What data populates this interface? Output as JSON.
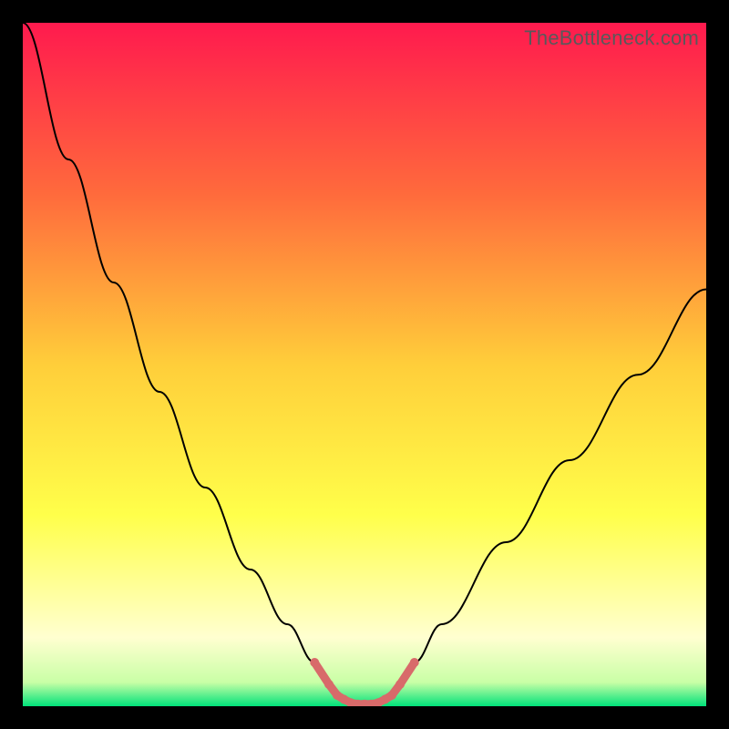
{
  "watermark": "TheBottleneck.com",
  "chart_data": {
    "type": "line",
    "title": "",
    "xlabel": "",
    "ylabel": "",
    "xlim": [
      0,
      100
    ],
    "ylim": [
      0,
      100
    ],
    "grid": false,
    "legend": false,
    "background_gradient": {
      "stops": [
        {
          "pos": 0.0,
          "color": "#ff1a4e"
        },
        {
          "pos": 0.25,
          "color": "#ff6a3c"
        },
        {
          "pos": 0.5,
          "color": "#ffce3a"
        },
        {
          "pos": 0.72,
          "color": "#ffff4a"
        },
        {
          "pos": 0.9,
          "color": "#ffffd0"
        },
        {
          "pos": 0.965,
          "color": "#c9ffa6"
        },
        {
          "pos": 1.0,
          "color": "#00e27a"
        }
      ]
    },
    "series": [
      {
        "name": "bottleneck-curve",
        "stroke": "#000000",
        "stroke_width": 2,
        "x": [
          0.0,
          6.7,
          13.3,
          20.0,
          26.7,
          33.3,
          38.7,
          42.7,
          44.8,
          46.0,
          48.0,
          50.0,
          52.0,
          54.0,
          55.2,
          57.3,
          61.3,
          70.7,
          80.0,
          90.0,
          100.0
        ],
        "y": [
          100.0,
          80.0,
          62.0,
          46.0,
          32.0,
          20.0,
          12.0,
          6.4,
          3.2,
          1.6,
          0.5,
          0.3,
          0.5,
          1.6,
          3.2,
          6.4,
          12.0,
          24.0,
          36.0,
          48.5,
          61.0
        ]
      },
      {
        "name": "optimal-marker",
        "type": "scatter",
        "stroke": "#d86a6a",
        "stroke_width": 9,
        "marker_radius": 5,
        "x": [
          42.7,
          44.8,
          46.0,
          47.0,
          48.0,
          49.0,
          50.0,
          51.0,
          52.0,
          53.0,
          54.0,
          55.2,
          57.3
        ],
        "y": [
          6.4,
          3.2,
          1.6,
          1.0,
          0.5,
          0.3,
          0.3,
          0.3,
          0.5,
          1.0,
          1.6,
          3.2,
          6.4
        ]
      }
    ]
  }
}
